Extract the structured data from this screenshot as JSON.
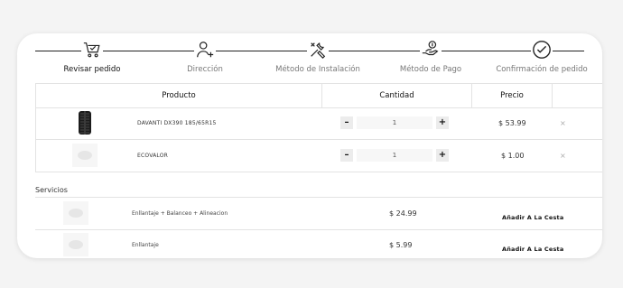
{
  "stepper": {
    "steps": [
      {
        "label": "Revisar pedido",
        "icon": "cart-check-icon",
        "active": true
      },
      {
        "label": "Dirección",
        "icon": "user-add-icon",
        "active": false
      },
      {
        "label": "Método de Instalación",
        "icon": "tools-icon",
        "active": false
      },
      {
        "label": "Método de Pago",
        "icon": "hand-coin-icon",
        "active": false
      },
      {
        "label": "Confirmación de pedido",
        "icon": "check-circle-icon",
        "active": false
      }
    ]
  },
  "cart": {
    "headers": {
      "product": "Producto",
      "quantity": "Cantidad",
      "price": "Precio"
    },
    "items": [
      {
        "name": "DAVANTI DX390 185/65R15",
        "qty": "1",
        "price": "$ 53.99",
        "remove": "×",
        "minus": "–",
        "plus": "+",
        "image": "tire-image"
      },
      {
        "name": "ECOVALOR",
        "qty": "1",
        "price": "$ 1.00",
        "remove": "×",
        "minus": "–",
        "plus": "+",
        "image": "placeholder-image"
      }
    ]
  },
  "services": {
    "title": "Servicios",
    "items": [
      {
        "name": "Enllantaje + Balanceo + Alineacion",
        "price": "$ 24.99",
        "button": "Añadir A La Cesta"
      },
      {
        "name": "Enllantaje",
        "price": "$ 5.99",
        "button": "Añadir A La Cesta"
      }
    ]
  }
}
